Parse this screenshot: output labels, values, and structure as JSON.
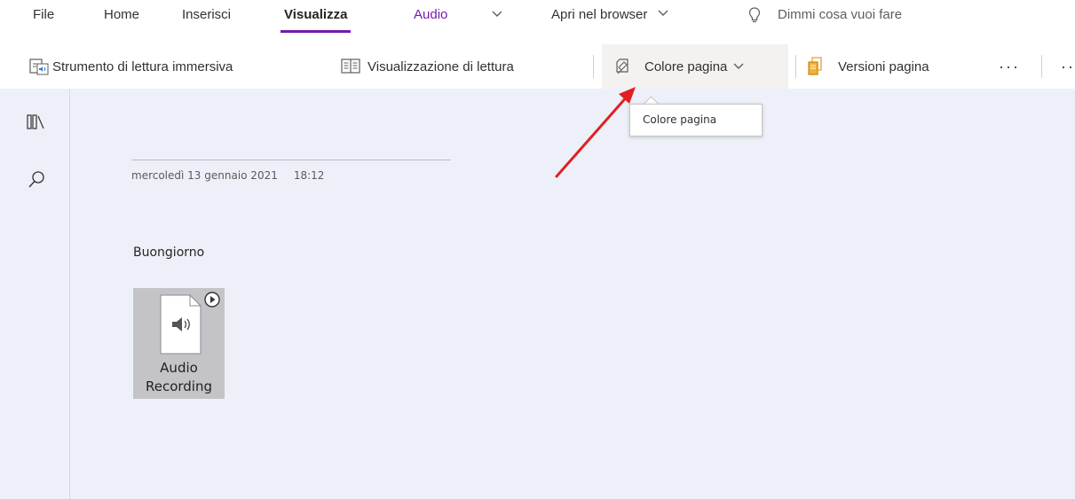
{
  "tabs": {
    "file": "File",
    "home": "Home",
    "insert": "Inserisci",
    "view": "Visualizza",
    "audio": "Audio",
    "open_browser": "Apri nel browser",
    "tell_me": "Dimmi cosa vuoi fare"
  },
  "ribbon": {
    "immersive_reader": "Strumento di lettura immersiva",
    "reading_view": "Visualizzazione di lettura",
    "page_color": "Colore pagina",
    "page_versions": "Versioni pagina",
    "more": "···"
  },
  "tooltip": {
    "text": "Colore pagina"
  },
  "page": {
    "date": "mercoledì 13 gennaio 2021",
    "time": "18:12",
    "body_text": "Buongiorno",
    "audio_label_line1": "Audio",
    "audio_label_line2": "Recording"
  },
  "colors": {
    "accent": "#7719aa",
    "annotation_arrow": "#e02020",
    "canvas": "#eef0f9",
    "audio_tile": "#c4c4c8"
  },
  "icons": {
    "immersive_reader": "immersive-reader-icon",
    "reading_view": "book-icon",
    "page_color": "page-color-icon",
    "page_versions": "page-versions-icon",
    "tell_me": "lightbulb-icon",
    "notebooks": "notebooks-icon",
    "search": "search-icon",
    "audio": "audio-file-icon",
    "play": "play-icon"
  }
}
